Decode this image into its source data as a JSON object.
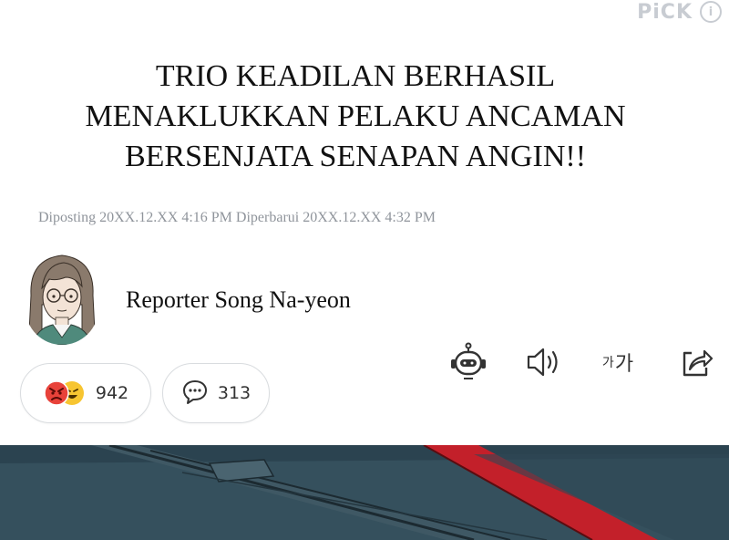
{
  "badge": {
    "label": "PiCK",
    "info_icon": "info-icon"
  },
  "article": {
    "headline_lines": [
      "TRIO KEADILAN BERHASIL",
      "MENAKLUKKAN PELAKU ANCAMAN",
      "BERSENJATA SENAPAN ANGIN!!"
    ],
    "dates": "Diposting 20XX.12.XX 4:16 PM Diperbarui 20XX.12.XX 4:32 PM",
    "reporter": "Reporter Song Na-yeon"
  },
  "toolbar": {
    "icons": [
      "robot-icon",
      "speaker-icon",
      "font-size-icon",
      "share-icon"
    ],
    "font_size_label_small": "가",
    "font_size_label_large": "가"
  },
  "reactions": {
    "count": "942",
    "icons": [
      "angry-face-icon",
      "laughing-face-icon"
    ]
  },
  "comments": {
    "count": "313",
    "icon": "comment-bubble-icon"
  },
  "colors": {
    "muted_text": "#8f949b",
    "badge_gray": "#c8ccd2",
    "angry_red": "#e8423a",
    "laugh_yellow": "#f7c531",
    "art_teal": "#39525f",
    "art_red": "#c3202a"
  }
}
